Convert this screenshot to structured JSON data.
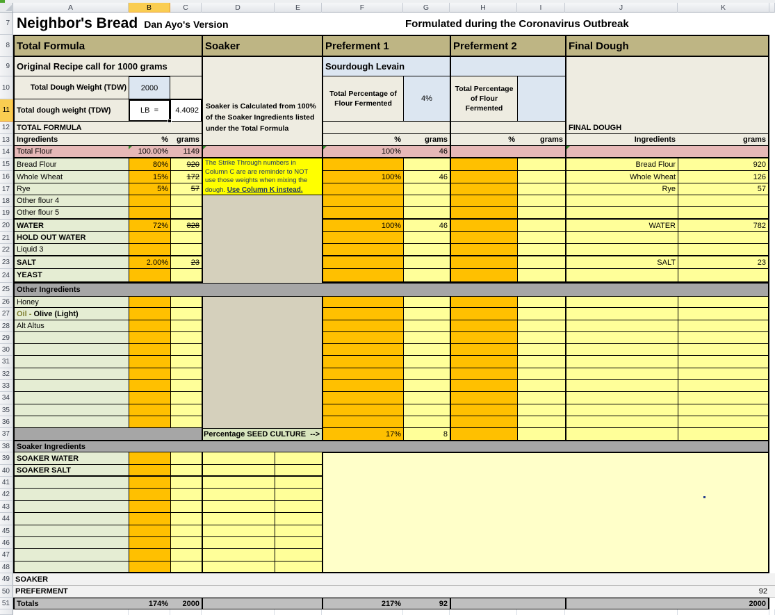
{
  "sheet": {
    "selected_column": "B",
    "selected_row": 11,
    "columns": [
      "A",
      "B",
      "C",
      "D",
      "E",
      "F",
      "G",
      "H",
      "I",
      "J",
      "K"
    ],
    "row_numbers": [
      7,
      8,
      9,
      10,
      11,
      12,
      13,
      14,
      15,
      16,
      17,
      18,
      19,
      20,
      21,
      22,
      23,
      24,
      25,
      26,
      27,
      28,
      29,
      30,
      31,
      32,
      33,
      34,
      35,
      36,
      37,
      38,
      39,
      40,
      41,
      42,
      43,
      44,
      45,
      46,
      47,
      48,
      49,
      50,
      51
    ],
    "cells": [
      {
        "c": "A",
        "r": 7,
        "cs": 6,
        "k": "white title",
        "n": "title-row",
        "parts": [
          {
            "t": "Neighbor's Bread",
            "k": "t1",
            "n": "workbook-title"
          },
          {
            "t": "Dan Ayo's Version",
            "k": "t2",
            "n": "workbook-subtitle"
          }
        ]
      },
      {
        "c": "G",
        "r": 7,
        "cs": 5,
        "t": "Formulated during the Coronavirus Outbreak",
        "k": "white lbl b f15",
        "n": "header-note"
      },
      {
        "c": "X",
        "r": 7,
        "rs": 42,
        "k": "white",
        "n": "right-margin"
      },
      {
        "c": "A",
        "r": 8,
        "cs": 3,
        "t": "Total Formula",
        "k": "sect lbl BT BB BL",
        "n": "section-total-formula"
      },
      {
        "c": "D",
        "r": 8,
        "cs": 2,
        "t": "Soaker",
        "k": "sect lbl BT BB BL",
        "n": "section-soaker"
      },
      {
        "c": "F",
        "r": 8,
        "cs": 2,
        "t": "Preferment 1",
        "k": "sect lbl BT BB BL",
        "n": "section-preferment-1"
      },
      {
        "c": "H",
        "r": 8,
        "cs": 2,
        "t": "Preferment 2",
        "k": "sect lbl BT BB BL",
        "n": "section-preferment-2"
      },
      {
        "c": "J",
        "r": 8,
        "cs": 2,
        "t": "Final Dough",
        "k": "sect lbl BT BB BL BR",
        "n": "section-final-dough"
      },
      {
        "c": "A",
        "r": 9,
        "cs": 3,
        "t": "Original Recipe call for 1000 grams",
        "k": "beige lbl b f13 BL bb",
        "n": "original-recipe-label"
      },
      {
        "c": "D",
        "r": 9,
        "cs": 2,
        "rs": 2,
        "k": "beige BL",
        "n": "cell-D9"
      },
      {
        "c": "F",
        "r": 9,
        "cs": 2,
        "t": "Sourdough Levain",
        "k": "blue lbl b f13 BL bb",
        "n": "sourdough-levain-label"
      },
      {
        "c": "H",
        "r": 9,
        "cs": 2,
        "k": "blue BL bb",
        "n": "cell-H9"
      },
      {
        "c": "J",
        "r": 9,
        "cs": 2,
        "rs": 3,
        "k": "beige BL BR",
        "n": "cell-J9"
      },
      {
        "c": "A",
        "r": 10,
        "t": "Total Dough Weight (TDW)",
        "k": "beige num b BL bb",
        "n": "tdw-label"
      },
      {
        "c": "B",
        "r": 10,
        "t": "2000",
        "k": "blue ctr bt bb bl br",
        "n": "tdw-value"
      },
      {
        "c": "C",
        "r": 10,
        "k": "beige bb",
        "n": "cell-C10"
      },
      {
        "c": "A",
        "r": 11,
        "t": "Total dough weight (TDW)",
        "k": "beige lbl b BL bb",
        "n": "tdw-lb-label"
      },
      {
        "c": "B",
        "r": 11,
        "t": "LB  =",
        "k": "white ctr sel",
        "n": "selected-cell-lb"
      },
      {
        "c": "C",
        "r": 11,
        "t": "4.4092",
        "k": "white num bt bb bl br",
        "n": "tdw-lb-value"
      },
      {
        "c": "D",
        "r": 11,
        "cs": 2,
        "rs": 3,
        "t": "Soaker is Calculated from 100% of the Soaker Ingredients listed under the Total Formula",
        "k": "beige wrap b BL bb",
        "n": "soaker-note"
      },
      {
        "c": "F",
        "r": 10,
        "rs": 2,
        "t": "Total Percentage of Flour Fermented",
        "k": "beige wrapc b BL bb",
        "n": "preferment1-flour-fermented-label"
      },
      {
        "c": "G",
        "r": 10,
        "rs": 2,
        "t": "4%",
        "k": "blue ctr bl bb",
        "n": "preferment1-percent"
      },
      {
        "c": "H",
        "r": 10,
        "rs": 2,
        "t": "Total Percentage of Flour Fermented",
        "k": "beige wrapc b BL bb",
        "n": "preferment2-flour-fermented-label"
      },
      {
        "c": "I",
        "r": 10,
        "rs": 2,
        "k": "blue bl bb",
        "n": "cell-I10"
      },
      {
        "c": "A",
        "r": 12,
        "cs": 3,
        "t": "TOTAL FORMULA",
        "k": "beige lbl b BL bb",
        "n": "total-formula-subheader"
      },
      {
        "c": "F",
        "r": 12,
        "cs": 2,
        "k": "beige BL bb",
        "n": "cell-F12"
      },
      {
        "c": "H",
        "r": 12,
        "cs": 2,
        "k": "beige BL bb",
        "n": "cell-H12"
      },
      {
        "c": "J",
        "r": 12,
        "t": "FINAL DOUGH",
        "k": "beige lbl b BL bb",
        "n": "final-dough-subheader"
      },
      {
        "c": "K",
        "r": 12,
        "k": "beige bb BR",
        "n": "cell-K12"
      },
      {
        "c": "A",
        "r": 13,
        "t": "Ingredients",
        "k": "beige lbl b BL bb",
        "n": "col-header-ingredients"
      },
      {
        "c": "B",
        "r": 13,
        "t": "%",
        "k": "beige num b bb",
        "n": "col-header-percent"
      },
      {
        "c": "C",
        "r": 13,
        "t": "grams",
        "k": "beige num b bb",
        "n": "col-header-grams"
      },
      {
        "c": "F",
        "r": 13,
        "t": "%",
        "k": "beige num b BL bb",
        "n": "col-header-p1-percent"
      },
      {
        "c": "G",
        "r": 13,
        "t": "grams",
        "k": "beige num b bb",
        "n": "col-header-p1-grams"
      },
      {
        "c": "H",
        "r": 13,
        "t": "%",
        "k": "beige num b BL bb",
        "n": "col-header-p2-percent"
      },
      {
        "c": "I",
        "r": 13,
        "t": "grams",
        "k": "beige num b bb",
        "n": "col-header-p2-grams"
      },
      {
        "c": "J",
        "r": 13,
        "t": "Ingredients",
        "k": "beige num b BL bb",
        "n": "col-header-fd-ingredients"
      },
      {
        "c": "K",
        "r": 13,
        "t": "grams",
        "k": "beige num b bb BR",
        "n": "col-header-fd-grams"
      },
      {
        "c": "A",
        "r": 14,
        "t": "Total Flour",
        "k": "pink lbl BL BB",
        "n": "total-flour-label"
      },
      {
        "c": "B",
        "r": 14,
        "t": "100.00%",
        "k": "pink num BB gt",
        "n": "total-flour-percent"
      },
      {
        "c": "C",
        "r": 14,
        "t": "1149",
        "k": "pink num BB",
        "n": "total-flour-grams"
      },
      {
        "c": "D",
        "r": 14,
        "cs": 2,
        "k": "pink BL BB gt",
        "n": "cell-D14"
      },
      {
        "c": "F",
        "r": 14,
        "t": "100%",
        "k": "pink num BL BB gt",
        "n": "p1-total-flour-percent"
      },
      {
        "c": "G",
        "r": 14,
        "t": "46",
        "k": "pink num BB",
        "n": "p1-total-flour-grams"
      },
      {
        "c": "H",
        "r": 14,
        "cs": 2,
        "k": "pink BL BB",
        "n": "cell-H14"
      },
      {
        "c": "J",
        "r": 14,
        "k": "pink BL BB gt",
        "n": "cell-J14"
      },
      {
        "c": "K",
        "r": 14,
        "k": "pink BB BR",
        "n": "cell-K14"
      },
      {
        "c": "D",
        "r": 15,
        "cs": 2,
        "rs": 3,
        "k": "noteY wrap2 BL bb",
        "n": "strike-through-note",
        "parts": [
          {
            "t": "The Strike Through numbers in Column C are are reminder to NOT use those weights when mixing the dough. ",
            "n": "note-body"
          },
          {
            "t": "Use Column K instead.",
            "k": "b f10 u",
            "n": "note-emphasis"
          }
        ]
      },
      {
        "c": "D",
        "r": 18,
        "cs": 2,
        "rs": 7,
        "k": "tan BL",
        "n": "soaker-blank-block-1"
      },
      {
        "c": "D",
        "r": 26,
        "cs": 2,
        "rs": 11,
        "k": "tan BL",
        "n": "soaker-blank-block-2"
      },
      {
        "c": "A",
        "r": 25,
        "cs": 11,
        "t": "Other Ingredients",
        "k": "band lbl b BL BR bt bb",
        "n": "band-other-ingredients"
      },
      {
        "c": "A",
        "r": 38,
        "cs": 11,
        "t": "Soaker Ingredients",
        "k": "band lbl b BL BR bt bb",
        "n": "band-soaker-ingredients"
      },
      {
        "c": "A",
        "r": 37,
        "cs": 3,
        "k": "band BL bb",
        "n": "band-row37-left"
      },
      {
        "c": "D",
        "r": 37,
        "cs": 2,
        "t": "Percentage SEED CULTURE  -->",
        "k": "seed num b bt bb BL",
        "n": "seed-culture-label"
      },
      {
        "c": "F",
        "r": 37,
        "t": "17%",
        "k": "orange num BL bb",
        "n": "seed-culture-percent"
      },
      {
        "c": "G",
        "r": 37,
        "t": "8",
        "k": "yellow num bl bb",
        "n": "seed-culture-grams"
      },
      {
        "c": "H",
        "r": 37,
        "k": "orange BL bb",
        "n": "cell-H37"
      },
      {
        "c": "I",
        "r": 37,
        "k": "yellow bl bb",
        "n": "cell-I37"
      },
      {
        "c": "J",
        "r": 37,
        "k": "yellow BL bb",
        "n": "cell-J37"
      },
      {
        "c": "K",
        "r": 37,
        "k": "yellow bl bb BR",
        "n": "cell-K37"
      },
      {
        "c": "F",
        "r": 39,
        "cs": 6,
        "rs": 10,
        "k": "cream BL BR BB bt",
        "dot": true,
        "n": "merged-empty-region"
      },
      {
        "c": "A",
        "r": 49,
        "cs": 12,
        "t": "SOAKER",
        "k": "ltrow lbl b gbb",
        "n": "row-soaker-summary"
      },
      {
        "c": "A",
        "r": 50,
        "cs": 10,
        "t": "PREFERMENT",
        "k": "ltrow lbl b gbb",
        "n": "row-preferment-summary"
      },
      {
        "c": "K",
        "r": 50,
        "t": "92",
        "k": "ltrow num gbb",
        "n": "preferment-total-grams"
      },
      {
        "c": "X",
        "r": 50,
        "k": "ltrow gbb",
        "n": "cell-X50"
      },
      {
        "c": "A",
        "r": 51,
        "t": "Totals",
        "k": "tot lbl b BL bt bb",
        "n": "totals-label"
      },
      {
        "c": "B",
        "r": 51,
        "t": "174%",
        "k": "tot num b bt bb",
        "n": "totals-percent"
      },
      {
        "c": "C",
        "r": 51,
        "t": "2000",
        "k": "tot num b bt bb",
        "n": "totals-grams"
      },
      {
        "c": "D",
        "r": 51,
        "cs": 2,
        "k": "tot BL bt bb",
        "n": "cell-D51"
      },
      {
        "c": "F",
        "r": 51,
        "t": "217%",
        "k": "tot num b BL bt bb",
        "n": "totals-p1-percent"
      },
      {
        "c": "G",
        "r": 51,
        "t": "92",
        "k": "tot num b bt bb",
        "n": "totals-p1-grams"
      },
      {
        "c": "H",
        "r": 51,
        "cs": 2,
        "k": "tot BL bt bb",
        "n": "cell-H51"
      },
      {
        "c": "J",
        "r": 51,
        "k": "tot BL bt bb",
        "n": "cell-J51"
      },
      {
        "c": "K",
        "r": 51,
        "t": "2000",
        "k": "tot num b bt bb BR",
        "n": "totals-fd-grams"
      },
      {
        "c": "X",
        "r": 51,
        "k": "white",
        "n": "cell-X51"
      }
    ],
    "ingredient_rows": [
      {
        "n": 15,
        "a": "Bread Flour",
        "b": "80%",
        "c": "920",
        "strike": true,
        "j": "Bread Flour",
        "kk": "920"
      },
      {
        "n": 16,
        "a": "Whole Wheat",
        "b": "15%",
        "c": "172",
        "strike": true,
        "f": "100%",
        "g": "46",
        "j": "Whole Wheat",
        "kk": "126"
      },
      {
        "n": 17,
        "a": "Rye",
        "b": "5%",
        "c": "57",
        "strike": true,
        "j": "Rye",
        "kk": "57"
      },
      {
        "n": 18,
        "a": "Other flour 4"
      },
      {
        "n": 19,
        "a": "Other flour 5",
        "end": true
      },
      {
        "n": 20,
        "a": "WATER",
        "bold": true,
        "b": "72%",
        "c": "828",
        "strike": true,
        "f": "100%",
        "g": "46",
        "j": "WATER",
        "kk": "782"
      },
      {
        "n": 21,
        "a": "HOLD OUT WATER",
        "bold": true
      },
      {
        "n": 22,
        "a": "Liquid 3",
        "end": true
      },
      {
        "n": 23,
        "a": "SALT",
        "bold": true,
        "b": "2.00%",
        "c": "23",
        "strike": true,
        "j": "SALT",
        "kk": "23"
      },
      {
        "n": 24,
        "a": "YEAST",
        "bold": true,
        "end": true
      },
      {
        "n": 26,
        "a": "Honey"
      },
      {
        "n": 27,
        "a_parts": [
          {
            "t": "Oil - ",
            "k": "olive",
            "n": "oil-label-prefix"
          },
          {
            "t": "Olive (Light)",
            "k": "b",
            "n": "oil-label-main"
          }
        ]
      },
      {
        "n": 28,
        "a": "Alt Altus"
      },
      {
        "n": 29
      },
      {
        "n": 30
      },
      {
        "n": 31
      },
      {
        "n": 32
      },
      {
        "n": 33
      },
      {
        "n": 34
      },
      {
        "n": 35
      },
      {
        "n": 36
      }
    ],
    "soaker_rows": [
      {
        "n": 39,
        "a": "SOAKER WATER",
        "bold": true
      },
      {
        "n": 40,
        "a": "SOAKER SALT",
        "bold": true,
        "end": true
      },
      {
        "n": 41
      },
      {
        "n": 42
      },
      {
        "n": 43
      },
      {
        "n": 44
      },
      {
        "n": 45
      },
      {
        "n": 46
      },
      {
        "n": 47
      },
      {
        "n": 48,
        "end": true
      }
    ]
  }
}
